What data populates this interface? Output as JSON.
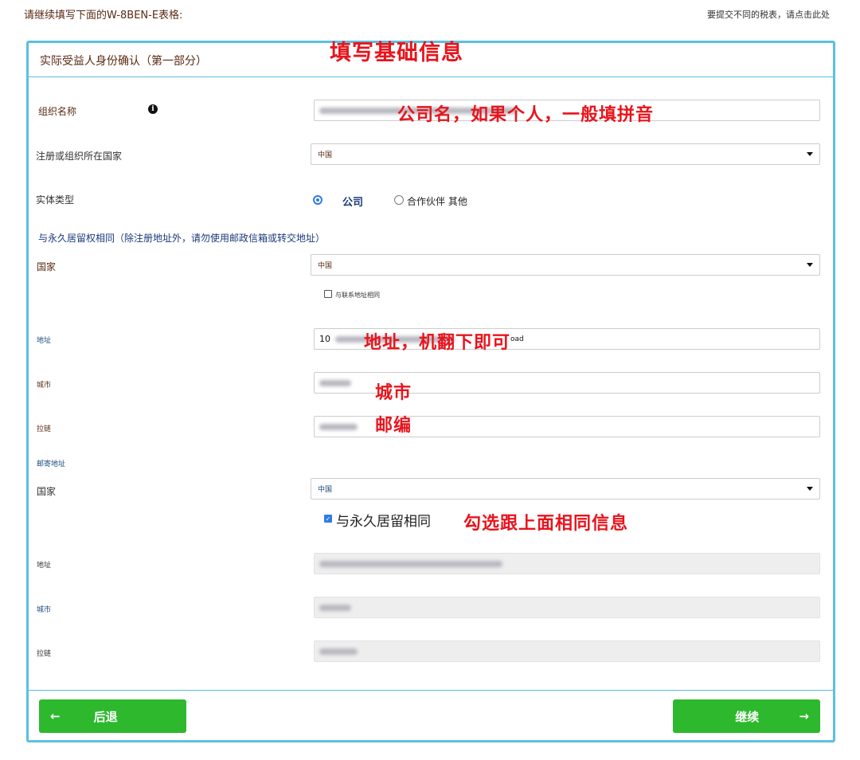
{
  "header": {
    "left_text": "请继续填写下面的W-8BEN-E表格:",
    "right_link": "要提交不同的税表，请点击此处"
  },
  "panel": {
    "title": "实际受益人身份确认（第一部分）"
  },
  "form": {
    "org_name_label": "组织名称",
    "country_reg_label": "注册或组织所在国家",
    "country_reg_value": "中国",
    "entity_type_label": "实体类型",
    "entity_options": [
      "公司",
      "合作伙伴 其他"
    ],
    "entity_selected": "公司",
    "permanent_section": "与永久居留权相同（除注册地址外，请勿使用邮政信箱或转交地址）",
    "perm_country_label": "国家",
    "perm_country_value": "中国",
    "same_as_contact_label": "与联系地址相同",
    "perm_address_label": "地址",
    "perm_address_prefix": "10",
    "perm_address_suffix": "oad",
    "perm_city_label": "城市",
    "perm_zip_label": "拉链",
    "mailing_section": "邮寄地址",
    "mail_country_label": "国家",
    "mail_country_value": "中国",
    "same_as_perm_label": "与永久居留相同",
    "mail_address_label": "地址",
    "mail_city_label": "城市",
    "mail_zip_label": "拉链"
  },
  "annotations": {
    "title_note": "填写基础信息",
    "org_note": "公司名，如果个人，一般填拼音",
    "address_note": "地址，机翻下即可",
    "city_note": "城市",
    "zip_note": "邮编",
    "same_note": "勾选跟上面相同信息"
  },
  "buttons": {
    "back": "后退",
    "next": "继续"
  },
  "colors": {
    "panel_border": "#5bc0de",
    "button_green": "#2db82d",
    "annotation_red": "#e8141c",
    "label_brown": "#5a2a14"
  }
}
